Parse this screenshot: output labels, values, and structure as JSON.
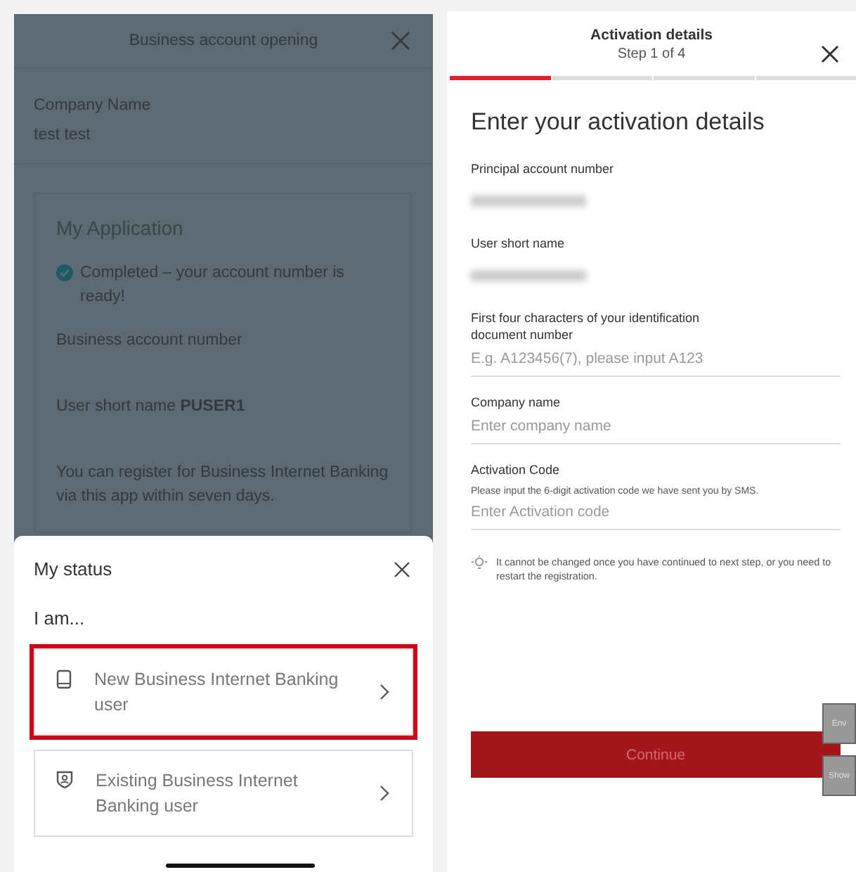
{
  "left_screen": {
    "header": {
      "title": "Business account opening"
    },
    "company": {
      "label": "Company Name",
      "value": "test test"
    },
    "application": {
      "title": "My Application",
      "status": "Completed – your account number is ready!",
      "account_label": "Business account number",
      "short_name": "User short name **PUSER1**",
      "note": "You can register for Business Internet Banking via this app within seven days."
    },
    "sheet": {
      "title": "My status",
      "prompt": "I am...",
      "options": [
        {
          "label": "New Business Internet Banking user",
          "kind": "device",
          "selected": true
        },
        {
          "label": "Existing Business Internet Banking user",
          "kind": "badge",
          "selected": false
        }
      ]
    }
  },
  "right_screen": {
    "header": {
      "title": "Activation details",
      "step": "Step 1 of 4"
    },
    "steps": [
      {
        "current": true
      },
      {
        "current": false
      },
      {
        "current": false
      },
      {
        "current": false
      }
    ],
    "heading": "Enter your activation details",
    "fields": [
      {
        "kind": "redacted",
        "label": "Principal account number"
      },
      {
        "kind": "redacted",
        "label": "User short name"
      },
      {
        "kind": "input",
        "label": "First four characters of your identification document number",
        "placeholder": "E.g. A123456(7), please input A123"
      },
      {
        "kind": "input",
        "label": "Company name",
        "placeholder": "Enter company name"
      },
      {
        "kind": "input",
        "label": "Activation Code",
        "hint": "Please input the 6-digit activation code we have sent you by SMS.",
        "placeholder": "Enter Activation code"
      }
    ],
    "tip": "It cannot be changed once you have continued to next step, or you need to restart the registration.",
    "continue_button": "Continue",
    "debug_buttons": [
      "Env",
      "Show"
    ]
  }
}
